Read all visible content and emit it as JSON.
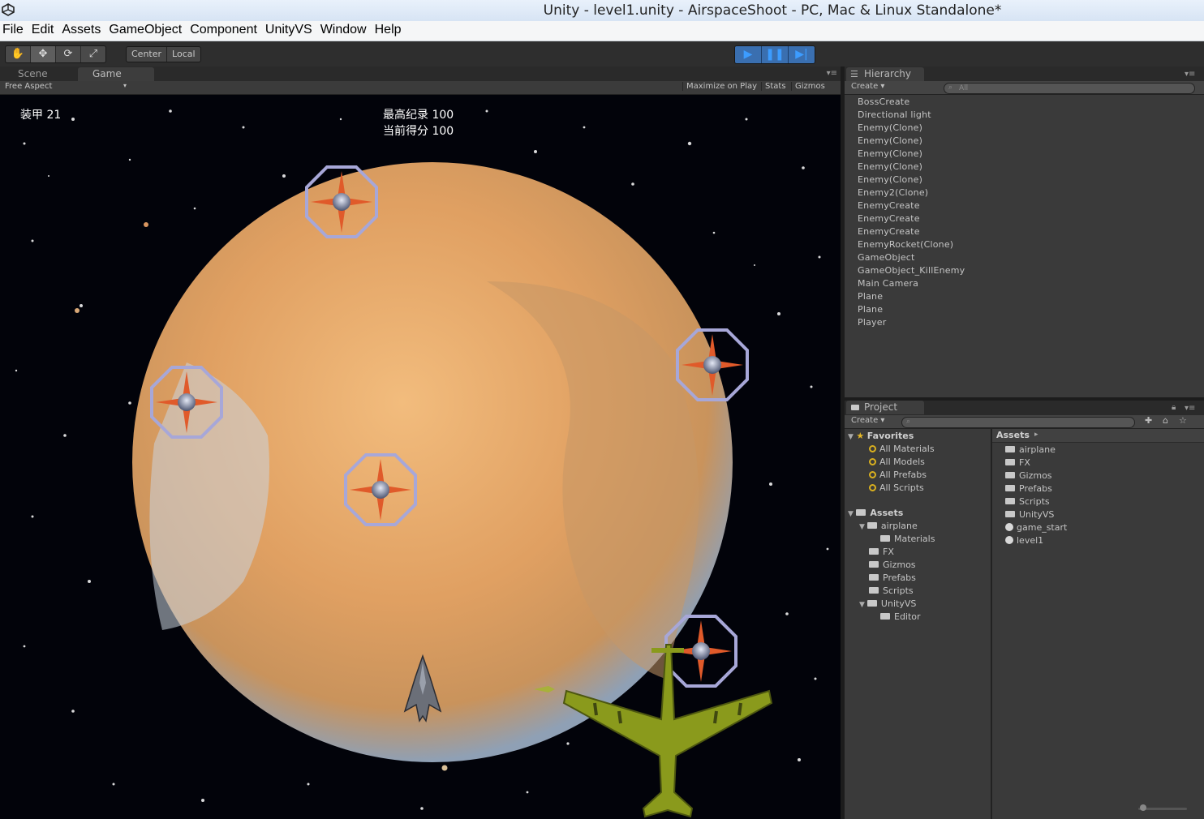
{
  "window": {
    "title": "Unity - level1.unity - AirspaceShoot - PC, Mac & Linux Standalone*"
  },
  "menu": [
    "File",
    "Edit",
    "Assets",
    "GameObject",
    "Component",
    "UnityVS",
    "Window",
    "Help"
  ],
  "toolbar": {
    "transform_tools": [
      "hand-icon",
      "move-icon",
      "rotate-icon",
      "scale-icon"
    ],
    "pivot_center": "Center",
    "pivot_local": "Local",
    "play_icons": [
      "play-icon",
      "pause-icon",
      "step-icon"
    ]
  },
  "scene_tabs": {
    "scene": "Scene",
    "game": "Game"
  },
  "game_bar": {
    "aspect": "Free Aspect",
    "maximize": "Maximize on Play",
    "stats": "Stats",
    "gizmos": "Gizmos"
  },
  "hud": {
    "armor": "装甲 21",
    "high_score": "最高纪录 100",
    "current_score": "当前得分 100"
  },
  "hierarchy": {
    "tab": "Hierarchy",
    "create": "Create",
    "search_placeholder": "All",
    "items": [
      "BossCreate",
      "Directional light",
      "Enemy(Clone)",
      "Enemy(Clone)",
      "Enemy(Clone)",
      "Enemy(Clone)",
      "Enemy(Clone)",
      "Enemy2(Clone)",
      "EnemyCreate",
      "EnemyCreate",
      "EnemyCreate",
      "EnemyRocket(Clone)",
      "GameObject",
      "GameObject_KillEnemy",
      "Main Camera",
      "Plane",
      "Plane",
      "Player"
    ]
  },
  "project": {
    "tab": "Project",
    "create": "Create",
    "favorites_label": "Favorites",
    "favorites": [
      "All Materials",
      "All Models",
      "All Prefabs",
      "All Scripts"
    ],
    "assets_label": "Assets",
    "tree": [
      {
        "label": "airplane",
        "depth": 1
      },
      {
        "label": "Materials",
        "depth": 2
      },
      {
        "label": "FX",
        "depth": 1
      },
      {
        "label": "Gizmos",
        "depth": 1
      },
      {
        "label": "Prefabs",
        "depth": 1
      },
      {
        "label": "Scripts",
        "depth": 1
      },
      {
        "label": "UnityVS",
        "depth": 1
      },
      {
        "label": "Editor",
        "depth": 2
      }
    ],
    "breadcrumb": "Assets",
    "contents": [
      {
        "label": "airplane",
        "kind": "folder"
      },
      {
        "label": "FX",
        "kind": "folder"
      },
      {
        "label": "Gizmos",
        "kind": "folder"
      },
      {
        "label": "Prefabs",
        "kind": "folder"
      },
      {
        "label": "Scripts",
        "kind": "folder"
      },
      {
        "label": "UnityVS",
        "kind": "folder"
      },
      {
        "label": "game_start",
        "kind": "scene"
      },
      {
        "label": "level1",
        "kind": "scene"
      }
    ]
  },
  "colors": {
    "planet": "#e3a463",
    "play_active": "#3a6fb0",
    "panel_bg": "#3a3a3a",
    "bomber": "#8a9a1c"
  }
}
